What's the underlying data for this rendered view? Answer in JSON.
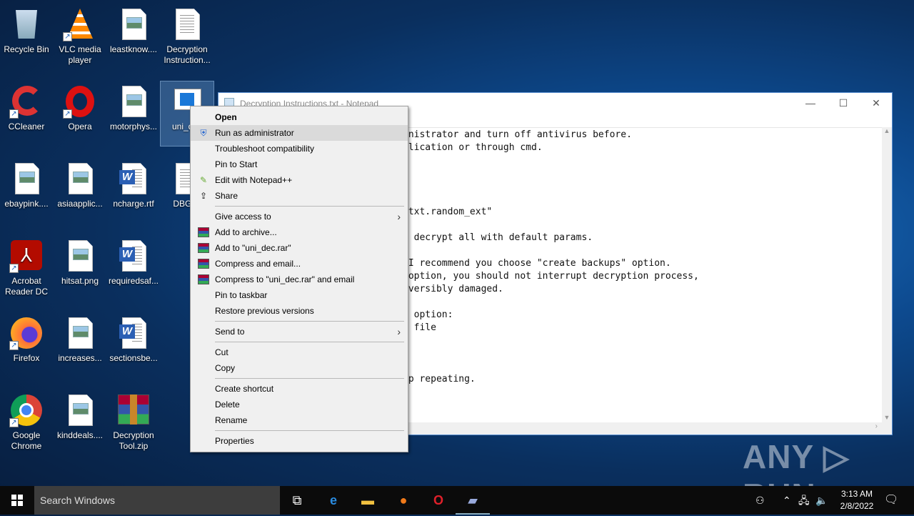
{
  "desktop": {
    "icons": [
      {
        "label": "Recycle Bin",
        "type": "bin"
      },
      {
        "label": "VLC media player",
        "type": "vlc"
      },
      {
        "label": "leastknow....",
        "type": "image"
      },
      {
        "label": "Decryption Instruction...",
        "type": "text"
      },
      {
        "label": "CCleaner",
        "type": "ccleaner"
      },
      {
        "label": "Opera",
        "type": "opera"
      },
      {
        "label": "motorphys...",
        "type": "image"
      },
      {
        "label": "uni_dec",
        "type": "exe"
      },
      {
        "label": "ebaypink....",
        "type": "image"
      },
      {
        "label": "asiaapplic...",
        "type": "image"
      },
      {
        "label": "ncharge.rtf",
        "type": "word"
      },
      {
        "label": "DBG_L",
        "type": "text"
      },
      {
        "label": "Acrobat Reader DC",
        "type": "acrobat"
      },
      {
        "label": "hitsat.png",
        "type": "image"
      },
      {
        "label": "requiredsaf...",
        "type": "word"
      },
      {
        "label": "Firefox",
        "type": "firefox"
      },
      {
        "label": "increases...",
        "type": "image"
      },
      {
        "label": "sectionsbe...",
        "type": "word"
      },
      {
        "label": "Google Chrome",
        "type": "chrome"
      },
      {
        "label": "kinddeals....",
        "type": "image"
      },
      {
        "label": "Decryption Tool.zip",
        "type": "rar"
      }
    ]
  },
  "notepad": {
    "title": "Decryption Instructions.txt - Notepad",
    "lines": [
      "inistrator and turn off antivirus before.",
      "plication or through cmd.",
      "",
      "",
      "",
      "",
      ".txt.random_ext\"",
      "",
      "l decrypt all with default params.",
      "",
      " I recommend you choose \"create backups\" option.",
      " option, you should not interrupt decryption process,",
      "eversibly damaged.",
      "",
      "\" option:",
      "d file",
      "",
      "",
      "",
      "op repeating."
    ]
  },
  "context_menu": {
    "items": [
      {
        "label": "Open",
        "bold": true
      },
      {
        "label": "Run as administrator",
        "icon": "shield-icon",
        "highlighted": true
      },
      {
        "label": "Troubleshoot compatibility"
      },
      {
        "label": "Pin to Start"
      },
      {
        "label": "Edit with Notepad++",
        "icon": "notepadpp-icon"
      },
      {
        "label": "Share",
        "icon": "share-icon"
      },
      {
        "sep": true
      },
      {
        "label": "Give access to",
        "submenu": true
      },
      {
        "label": "Add to archive...",
        "icon": "winrar-icon"
      },
      {
        "label": "Add to \"uni_dec.rar\"",
        "icon": "winrar-icon"
      },
      {
        "label": "Compress and email...",
        "icon": "winrar-icon"
      },
      {
        "label": "Compress to \"uni_dec.rar\" and email",
        "icon": "winrar-icon"
      },
      {
        "label": "Pin to taskbar"
      },
      {
        "label": "Restore previous versions"
      },
      {
        "sep": true
      },
      {
        "label": "Send to",
        "submenu": true
      },
      {
        "sep": true
      },
      {
        "label": "Cut"
      },
      {
        "label": "Copy"
      },
      {
        "sep": true
      },
      {
        "label": "Create shortcut"
      },
      {
        "label": "Delete"
      },
      {
        "label": "Rename"
      },
      {
        "sep": true
      },
      {
        "label": "Properties"
      }
    ]
  },
  "taskbar": {
    "search_placeholder": "Search Windows",
    "time": "3:13 AM",
    "date": "2/8/2022"
  },
  "watermark": "ANY ▷ RUN"
}
